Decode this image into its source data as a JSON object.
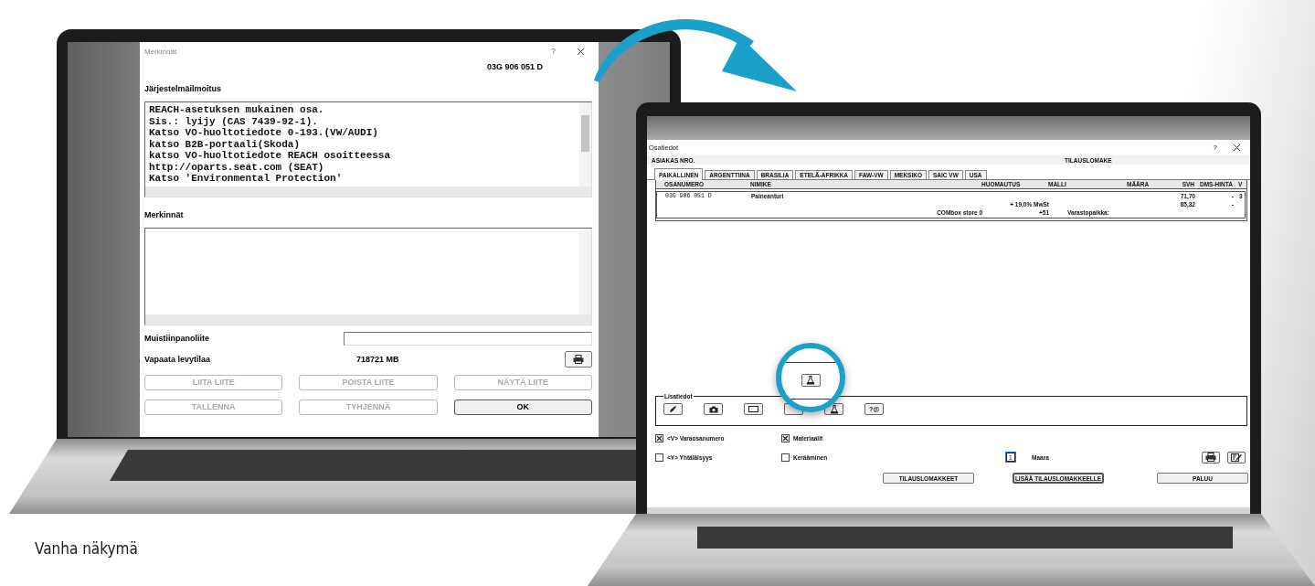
{
  "old_view": {
    "dialog": {
      "title": "Merkinnät",
      "help": "?",
      "part_number": "03G 906 051 D",
      "system_message_label": "Järjestelmäilmoitus",
      "system_message_lines": [
        "REACH-asetuksen mukainen osa.",
        "Sis.: lyijy (CAS 7439-92-1).",
        "Katso VO-huoltotiedote 0-193.(VW/AUDI)",
        "katso B2B-portaali(Skoda)",
        "katso VO-huoltotiedote REACH osoitteessa",
        "http://oparts.seat.com (SEAT)",
        "Katso 'Environmental Protection'"
      ],
      "notes_label": "Merkinnät",
      "attachment_label": "Muistiinpanoliite",
      "free_space_label": "Vapaata levytilaa",
      "free_space_value": "718721 MB",
      "buttons": [
        {
          "label": "LIITA LIITE",
          "disabled": true
        },
        {
          "label": "POISTA LIITE",
          "disabled": true
        },
        {
          "label": "NÄYTÄ LIITE",
          "disabled": true
        },
        {
          "label": "TALLENNA",
          "disabled": true
        },
        {
          "label": "TYHJENNÄ",
          "disabled": true
        },
        {
          "label": "OK",
          "disabled": false
        }
      ]
    }
  },
  "new_view": {
    "window": {
      "title": "Osatiedot",
      "help": "?",
      "customer_label": "ASIAKAS NRO.",
      "order_form_label": "TILAUSLOMAKE",
      "tabs": [
        {
          "label": "PAIKALLINEN",
          "selected": true
        },
        {
          "label": "ARGENTTIINA",
          "selected": false
        },
        {
          "label": "BRASILIA",
          "selected": false
        },
        {
          "label": "ETELÄ-AFRIKKA",
          "selected": false
        },
        {
          "label": "FAW-VW",
          "selected": false
        },
        {
          "label": "MEKSIKO",
          "selected": false
        },
        {
          "label": "SAIC VW",
          "selected": false
        },
        {
          "label": "USA",
          "selected": false
        }
      ],
      "table": {
        "columns": [
          "OSANUMERO",
          "NIMIKE",
          "HUOMAUTUS",
          "MALLI",
          "MÄÄRA",
          "SVH",
          "DMS-HINTA",
          "V"
        ],
        "part_row": {
          "part_number": "03G 906 051 D",
          "name": "Paineanturi",
          "price": "71,70",
          "dms_price": "-",
          "v": "3"
        },
        "vat_row": {
          "note": "+ 19,0% MwSt",
          "price": "85,32",
          "dms_price": "-"
        },
        "stock_row": {
          "store": "COMbox store 0",
          "count": "+51",
          "location_label": "Varastopaikka:"
        }
      },
      "details": {
        "label": "Lisatiedot",
        "text_button": "?@"
      },
      "options": [
        {
          "label": "<V> Varaosanumero",
          "checked": true
        },
        {
          "label": "Materiaalit",
          "checked": true
        },
        {
          "label": "<Y> Yhtäläisyys",
          "checked": false
        },
        {
          "label": "Kerääminen",
          "checked": false
        }
      ],
      "quantity": {
        "label": "Maara",
        "value": "1"
      },
      "buttons": [
        {
          "label": "TILAUSLOMAKKEET",
          "default": false
        },
        {
          "label": "LISÄÄ TILAUSLOMAKKEELLE",
          "default": true
        },
        {
          "label": "PALUU",
          "default": false
        }
      ]
    }
  },
  "caption": "Vanha näkymä"
}
